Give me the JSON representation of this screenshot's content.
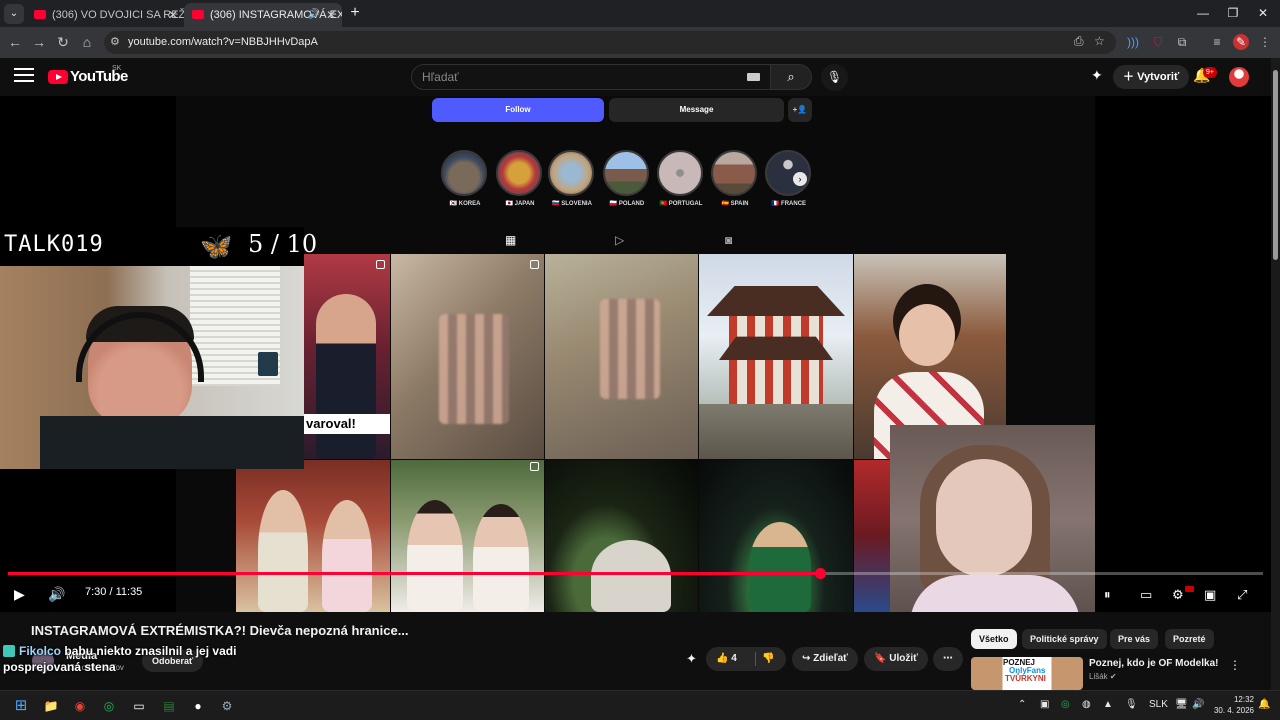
{
  "browser": {
    "tabs": [
      {
        "title": "(306) VO DVOJICI SA REŽE LEPŠ"
      },
      {
        "title": "(306) INSTAGRAMOVÁ EXTR",
        "active": true
      }
    ],
    "url": "youtube.com/watch?v=NBBJHHvDapA"
  },
  "youtube": {
    "logo_text": "YouTube",
    "country_code": "SK",
    "search_placeholder": "Hľadať",
    "create_label": "Vytvoriť",
    "notification_count": "9+"
  },
  "instagram": {
    "follow_label": "Follow",
    "message_label": "Message",
    "highlights": [
      {
        "label": "🇰🇷 KOREA"
      },
      {
        "label": "🇯🇵 JAPAN"
      },
      {
        "label": "🇸🇮 SLOVENIA"
      },
      {
        "label": "🇵🇱 POLAND"
      },
      {
        "label": "🇵🇹 PORTUGAL"
      },
      {
        "label": "🇪🇸 SPAIN"
      },
      {
        "label": "🇫🇷 FRANCE"
      }
    ],
    "post_caption": "varoval!"
  },
  "overlay": {
    "stream_label": "TALK019",
    "counter": "5 / 10"
  },
  "player": {
    "current_time": "7:30",
    "duration": "11:35",
    "progress": 0.647
  },
  "video": {
    "title": "INSTAGRAMOVÁ EXTRÉMISTKA?! Dievča nepozná hranice...",
    "channel": "Media",
    "subscribers": "131 odberateľov",
    "unsubscribe_label": "Odoberať",
    "likes": "4",
    "share_label": "Zdieľať",
    "save_label": "Uložiť",
    "chat_user": "Fikolco",
    "chat_text": "babu niekto znasilnil a jej vadi posprejovaná stena"
  },
  "sidebar": {
    "chips": [
      "Všetko",
      "Politické správy",
      "Pre vás",
      "Pozreté"
    ],
    "recommendation": {
      "thumb_line1": "POZNEJ",
      "thumb_line2": "OnlyFans",
      "thumb_line3": "TVŮRKYNI",
      "title": "Poznej, kdo je OF Modelka!",
      "channel": "Lišák"
    }
  },
  "taskbar": {
    "language": "SLK",
    "time": "12:32",
    "date": "30. 4. 2026"
  },
  "colors": {
    "youtube_red": "#ff0033",
    "instagram_blue": "#4f5bff",
    "background": "#0f0f0f"
  }
}
